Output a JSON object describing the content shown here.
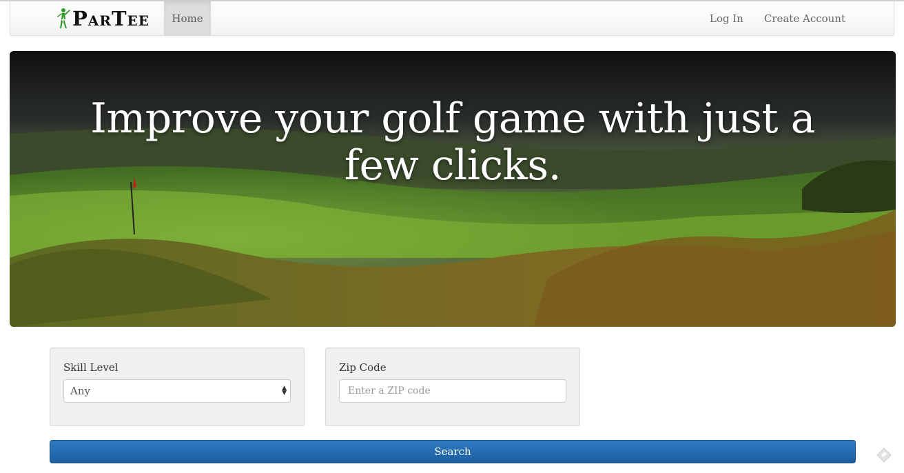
{
  "navbar": {
    "brand": "ParTee",
    "brand_icon": "golfer-logo-icon",
    "home_label": "Home",
    "login_label": "Log In",
    "create_account_label": "Create Account"
  },
  "hero": {
    "headline": "Improve your golf game with just a few clicks."
  },
  "form": {
    "skill_label": "Skill Level",
    "skill_selected": "Any",
    "zip_label": "Zip Code",
    "zip_placeholder": "Enter a ZIP code",
    "zip_value": "",
    "search_label": "Search"
  },
  "colors": {
    "brand_green": "#2e9a2a",
    "button_blue": "#2a6fb3"
  },
  "icons": {
    "select_arrows": "up-down-arrows-icon",
    "corner": "eraser-icon"
  }
}
